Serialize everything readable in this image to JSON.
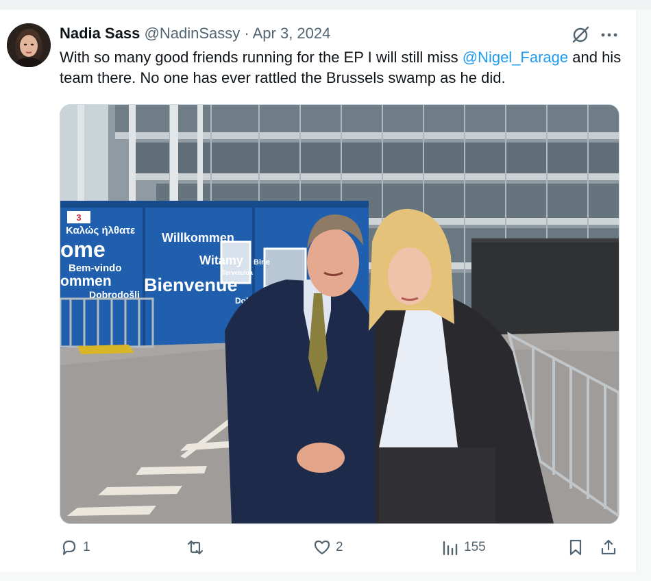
{
  "tweet": {
    "author_name": "Nadia Sass",
    "author_handle": "@NadinSassy",
    "separator": "·",
    "date": "Apr 3, 2024",
    "text_before": "With so many good friends running for the EP I will still miss ",
    "mention": "@Nigel_Farage",
    "text_after": " and his team there. No one has ever rattled the Brussels swamp as he did.",
    "photo_signage": {
      "s1": "Καλώς ήλθατε",
      "s2": "ome",
      "s3": "Bem-vindo",
      "s4": "ommen",
      "s5": "Dobrodošli",
      "s6": "Willkommen",
      "s7": "Witamy",
      "s8": "Bienvenue",
      "s9": "Dobro",
      "s10": "Tervetuloa",
      "s11": "3",
      "s12": "Bine"
    }
  },
  "actions": {
    "replies": "1",
    "reposts": "",
    "likes": "2",
    "views": "155"
  },
  "icons": {
    "grok": "grok-icon",
    "more": "more-icon",
    "reply": "reply-icon",
    "repost": "repost-icon",
    "like": "heart-icon",
    "views": "views-icon",
    "bookmark": "bookmark-icon",
    "share": "share-icon"
  },
  "colors": {
    "accent": "#1d9bf0",
    "text": "#0f1419",
    "muted": "#536471"
  }
}
